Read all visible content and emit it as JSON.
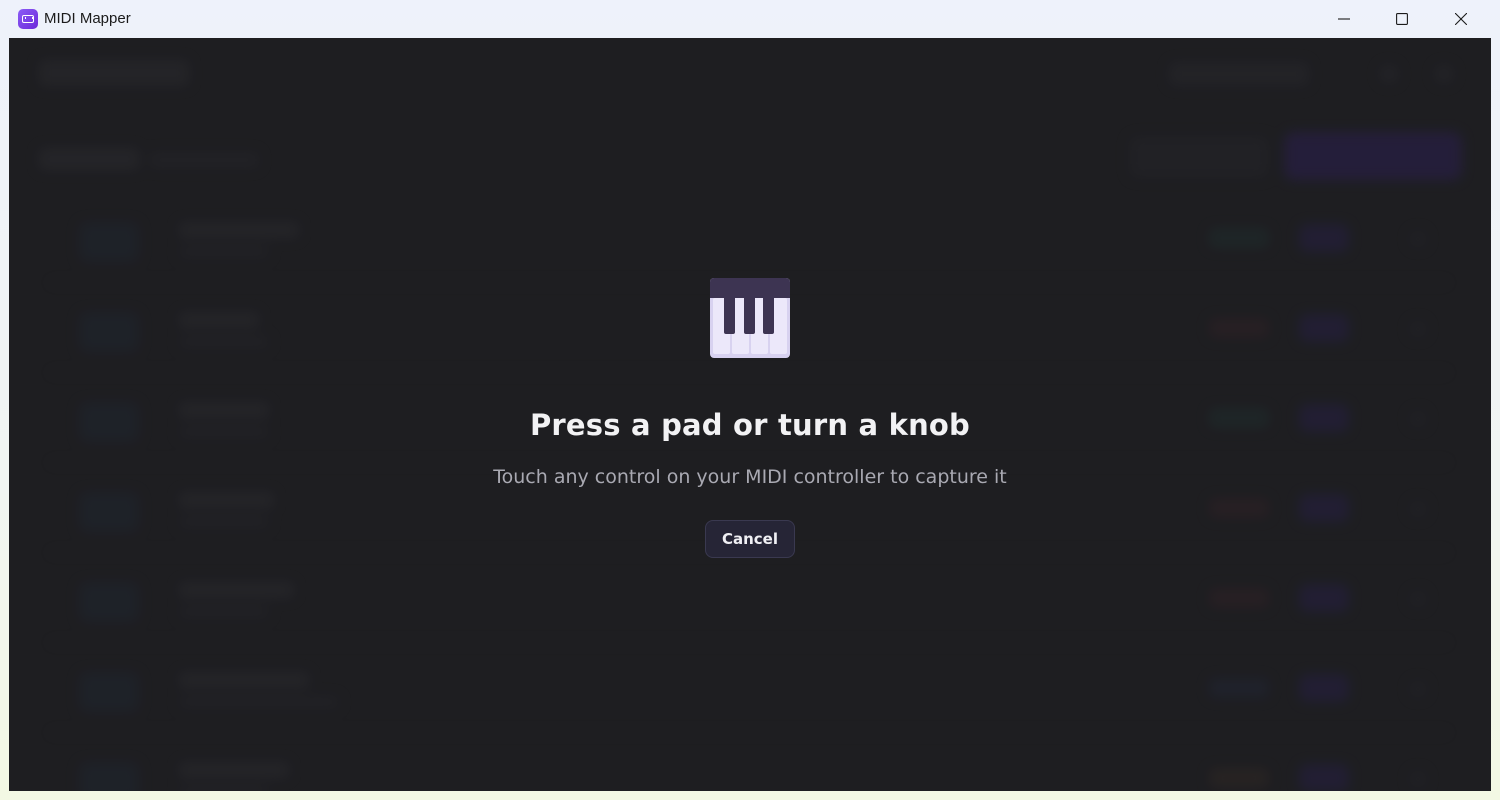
{
  "window": {
    "title": "MIDI Mapper",
    "icon": "midi-keyboard-icon",
    "controls": [
      "minimize-icon",
      "maximize-icon",
      "close-icon"
    ]
  },
  "capture_prompt": {
    "icon": "piano-keys-icon",
    "title": "Press a pad or turn a knob",
    "subtitle": "Touch any control on your MIDI controller to capture it",
    "cancel_label": "Cancel"
  },
  "colors": {
    "accent": "#6d28d9",
    "overlay": "#1f1f22",
    "title_text": "#f2f2f4",
    "subtitle_text": "#a9a9b2",
    "button_bg": "#262536"
  }
}
